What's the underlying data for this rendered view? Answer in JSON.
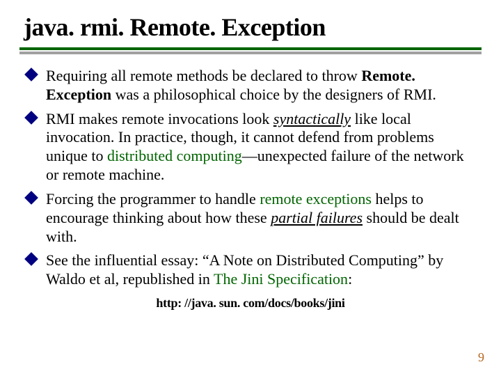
{
  "title": "java. rmi. Remote. Exception",
  "bullets": [
    {
      "pre": "Requiring all remote methods be declared to throw ",
      "bold": "Remote. Exception",
      "post": " was a philosophical choice by the designers of RMI."
    },
    {
      "pre": "RMI makes remote invocations look ",
      "em": "syntactically",
      "mid": " like local invocation.  In practice, though, it cannot defend from problems unique to ",
      "green1": "distributed computing",
      "post": "—unexpected failure of the network or remote machine."
    },
    {
      "pre": "Forcing the programmer to handle ",
      "green1": "remote exceptions",
      "mid": " helps to encourage thinking about how these ",
      "em": "partial failures",
      "post": " should be dealt with."
    },
    {
      "pre": "See the influential essay: “A Note on Distributed Computing” by Waldo et al, republished in ",
      "green1": "The Jini Specification",
      "post": ":"
    }
  ],
  "url": "http: //java. sun. com/docs/books/jini",
  "pagenum": "9"
}
